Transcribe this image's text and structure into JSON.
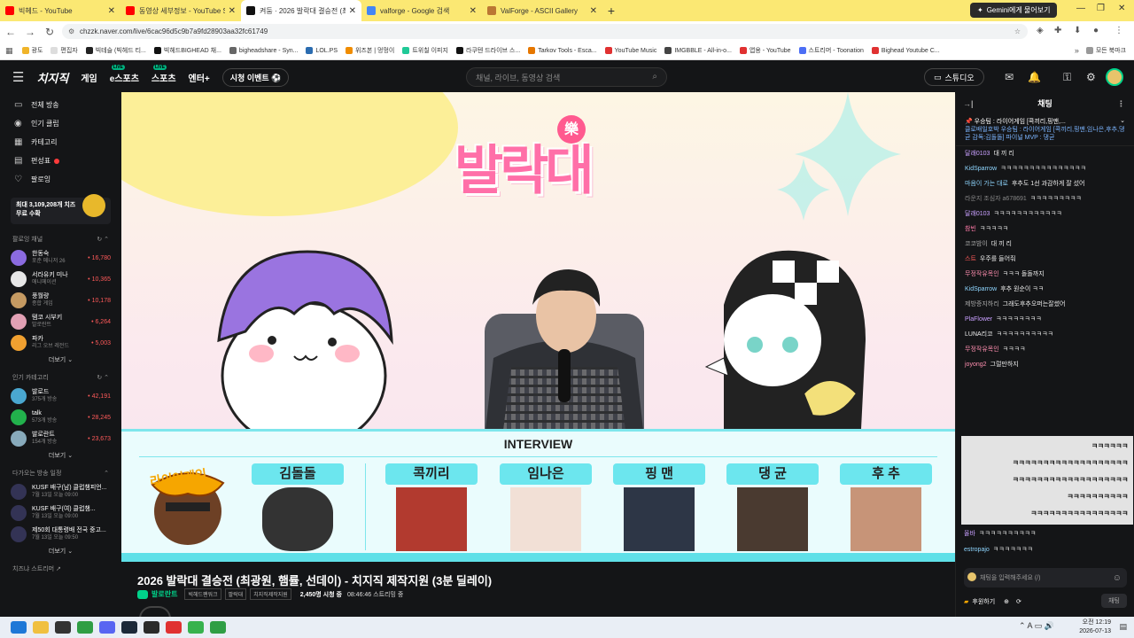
{
  "browser": {
    "tabs": [
      {
        "title": "빅헤드 - YouTube",
        "color": "#ff0000"
      },
      {
        "title": "동영상 세부정보 - YouTube Studio",
        "color": "#ff0000"
      },
      {
        "title": "켜둠 · 2026 발락대 결승전 (최",
        "color": "#111111"
      },
      {
        "title": "valforge - Google 검색",
        "color": "#4285f4"
      },
      {
        "title": "ValForge - ASCII Gallery",
        "color": "#bb7733"
      }
    ],
    "gemini_label": "Gemini에게 물어보기",
    "url": "chzzk.naver.com/live/6cac96d5c9b7a9fd28903aa32fc61749",
    "bookmarks": [
      "광도",
      "편집자",
      "빅테슬 (빅헤드 티...",
      "빅헤드BIGHEAD 채...",
      "bigheadshare - Syn...",
      "LOL.PS",
      "위즈본 | 멍멍이",
      "트위칠 이피지",
      "라쿠텐 드라이브 스...",
      "Tarkov Tools - Esca...",
      "YouTube Music",
      "IMGBBLE - All-in-o...",
      "앱용 - YouTube",
      "스트리머 - Toonation",
      "Bighead Youtube C..."
    ],
    "bookmark_all": "모든 북마크"
  },
  "topnav": {
    "logo": "치지직",
    "items": [
      "게임",
      "e스포츠",
      "스포츠",
      "엔터+"
    ],
    "mini_badge": "LIVE",
    "event_button": "시청 이벤트 ⚽",
    "search_placeholder": "채널, 라이브, 동영상 검색",
    "studio": "스튜디오"
  },
  "sidebar": {
    "menu": [
      {
        "label": "전체 방송",
        "icon": "▭"
      },
      {
        "label": "인기 클립",
        "icon": "◉"
      },
      {
        "label": "카테고리",
        "icon": "▦"
      },
      {
        "label": "편성표",
        "icon": "▤"
      },
      {
        "label": "팔로잉",
        "icon": "♡"
      }
    ],
    "promo": "최대 3,109,208개 치즈 무료 수확",
    "following_title": "팔로잉 채널",
    "following": [
      {
        "name": "한동숙",
        "sub": "포춘 메니저 26",
        "viewers": "16,780",
        "color": "#8b6be0"
      },
      {
        "name": "서라유키 미나",
        "sub": "애니메이션",
        "viewers": "10,365",
        "color": "#e7e7e7"
      },
      {
        "name": "풍월량",
        "sub": "종합 게임",
        "viewers": "10,178",
        "color": "#c59a62"
      },
      {
        "name": "탬코 시부키",
        "sub": "발로란트",
        "viewers": "6,264",
        "color": "#e1a0b4"
      },
      {
        "name": "파카",
        "sub": "리그 오브 레전드",
        "viewers": "5,003",
        "color": "#f0a030"
      }
    ],
    "more_label": "더보기",
    "category_title": "인기 카테고리",
    "categories": [
      {
        "name": "발로드",
        "sub": "375개 방송",
        "viewers": "42,191",
        "color": "#4aa7d0"
      },
      {
        "name": "talk",
        "sub": "573개 방송",
        "viewers": "28,245",
        "color": "#22b14c"
      },
      {
        "name": "발로란트",
        "sub": "154개 방송",
        "viewers": "23,673",
        "color": "#8ab"
      }
    ],
    "upcoming_title": "다가오는 방송 일정",
    "upcoming": [
      {
        "name": "KUSF 배구(남) 클럽챔피언...",
        "sub": "7월 13일 오늘 09:00"
      },
      {
        "name": "KUSF 배구(여) 클럽챔...",
        "sub": "7월 13일 오늘 09:00"
      },
      {
        "name": "제50회 대통령배 전국 중고...",
        "sub": "7월 13일 오늘 09:50"
      }
    ],
    "footer": "치즈냐 스트리머 ↗"
  },
  "player": {
    "logo_text": "발락대",
    "logo_badge": "樂",
    "interview_label": "INTERVIEW",
    "members": [
      {
        "name": "김돌돌",
        "color": "#333333"
      },
      {
        "name": "콕끼리",
        "color": "#b23a2f"
      },
      {
        "name": "임나은",
        "color": "#f2e0d6"
      },
      {
        "name": "핑 맨",
        "color": "#2d3646"
      },
      {
        "name": "댕 균",
        "color": "#4a3a30"
      },
      {
        "name": "후 추",
        "color": "#c79478"
      }
    ],
    "team_logo": "라이어게임"
  },
  "stream": {
    "title": "2026 발락대 결승전 (최광원, 햄률, 선데이) - 치지직 제작지원 (3분 딜레이)",
    "channel": "발로란트",
    "tags": [
      "빅헤드팬워크",
      "팔락대",
      "치지직제작지원"
    ],
    "viewers": "2,450명 시청 중",
    "uptime": "08:46:46 스트리밍 중"
  },
  "chat": {
    "title": "채팅",
    "pinned_title": "우승팀 : 라이어게임 [콕끼리,핑맨,...",
    "pinned_body": "클로배일호박 우승팀 : 라이어게임 [콕끼리,핑맨,임나은,후추,댕균 감독:김돌돌] 파이널 MVP : 댕균",
    "messages": [
      {
        "user": "달래0103",
        "text": "대 끼 리",
        "color": "#c9a0ff"
      },
      {
        "user": "KidSparrow",
        "text": "ㅋㅋㅋㅋㅋㅋㅋㅋㅋㅋㅋㅋㅋㅋㅋ",
        "color": "#8fd6ff"
      },
      {
        "user": "마음이 가는 대로",
        "text": "후추도 1선 과감하게 잘 섰어",
        "color": "#8fd6ff"
      },
      {
        "user": "라운지 조심자 a678691",
        "text": "ㅋㅋㅋㅋㅋㅋㅋㅋㅋ",
        "color": "#888888"
      },
      {
        "user": "달래0103",
        "text": "ㅋㅋㅋㅋㅋㅋㅋㅋㅋㅋㅋㅋ",
        "color": "#c9a0ff"
      },
      {
        "user": "참빈",
        "text": "ㅋㅋㅋㅋㅋ",
        "color": "#ff7ba9"
      },
      {
        "user": "코코밤이",
        "text": "대 끼 리",
        "color": "#aaaaaa"
      },
      {
        "user": "스트",
        "text": "우주를 들어줘",
        "color": "#ff5a5a"
      },
      {
        "user": "무정작유목인",
        "text": "ㅋㅋㅋ 돌돌까지",
        "color": "#ff8fb0"
      },
      {
        "user": "KidSparrow",
        "text": "후추 원순이 ㅋㅋ",
        "color": "#8fd6ff"
      },
      {
        "user": "제방증지하리",
        "text": "그래도후추오퍼는잘썼어",
        "color": "#aaaaaa"
      },
      {
        "user": "PlaFlower",
        "text": "ㅋㅋㅋㅋㅋㅋㅋㅋ",
        "color": "#c9a0ff"
      },
      {
        "user": "LUNA리코",
        "text": "ㅋㅋㅋㅋㅋㅋㅋㅋㅋㅋ",
        "color": "#eeeeee"
      },
      {
        "user": "무정작유목인",
        "text": "ㅋㅋㅋㅋ",
        "color": "#ff8fb0"
      },
      {
        "user": "joyong2",
        "text": "그럴만하지",
        "color": "#ff8fb0"
      }
    ],
    "overlay_lines": [
      "ㅋㅋㅋㅋㅋㅋ",
      "ㅋㅋㅋㅋㅋㅋㅋㅋㅋㅋㅋㅋㅋㅋㅋㅋㅋㅋㅋ",
      "ㅋㅋㅋㅋㅋㅋㅋㅋㅋㅋㅋㅋㅋㅋㅋㅋㅋㅋㅋ",
      "ㅋㅋㅋㅋㅋㅋㅋㅋㅋㅋ",
      "ㅋㅋㅋㅋㅋㅋㅋㅋㅋㅋㅋㅋㅋㅋㅋㅋ"
    ],
    "after": [
      {
        "user": "올바",
        "text": "ㅋㅋㅋㅋㅋㅋㅋㅋㅋㅋ",
        "color": "#c9a0ff"
      },
      {
        "user": "estropajo",
        "text": "ㅋㅋㅋㅋㅋㅋㅋ",
        "color": "#8fd6ff"
      }
    ],
    "input_placeholder": "채팅을 입력해주세요 (/)",
    "support_label": "후원하기",
    "send_label": "채팅"
  },
  "taskbar": {
    "time": "오전 12:19",
    "date": "2026-07-13",
    "ime": "A"
  }
}
